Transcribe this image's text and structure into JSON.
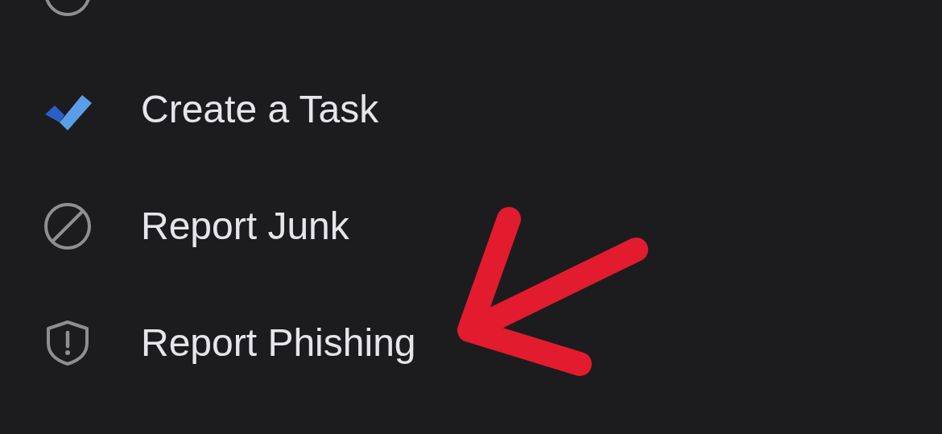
{
  "menu": {
    "items": [
      {
        "kind": "snooze"
      },
      {
        "label": "Create a Task",
        "kind": "task"
      },
      {
        "label": "Report Junk",
        "kind": "junk"
      },
      {
        "label": "Report Phishing",
        "kind": "phishing"
      }
    ]
  }
}
